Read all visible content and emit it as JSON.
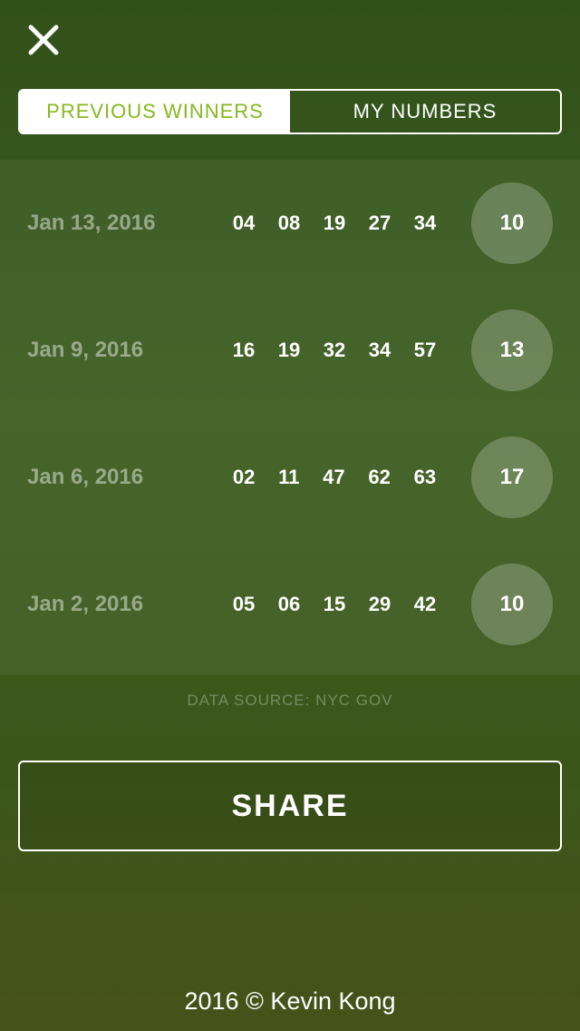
{
  "header": {
    "close_icon": "close-icon"
  },
  "tabs": [
    {
      "label": "PREVIOUS WINNERS",
      "active": true
    },
    {
      "label": "MY NUMBERS",
      "active": false
    }
  ],
  "draws": [
    {
      "date": "Jan 13, 2016",
      "numbers": [
        "04",
        "08",
        "19",
        "27",
        "34"
      ],
      "ball": "10"
    },
    {
      "date": "Jan 9, 2016",
      "numbers": [
        "16",
        "19",
        "32",
        "34",
        "57"
      ],
      "ball": "13"
    },
    {
      "date": "Jan 6, 2016",
      "numbers": [
        "02",
        "11",
        "47",
        "62",
        "63"
      ],
      "ball": "17"
    },
    {
      "date": "Jan 2, 2016",
      "numbers": [
        "05",
        "06",
        "15",
        "29",
        "42"
      ],
      "ball": "10"
    }
  ],
  "data_source": "DATA SOURCE: NYC GOV",
  "share_label": "SHARE",
  "footer": "2016 © Kevin Kong",
  "colors": {
    "accent": "#86b81e",
    "background": "#3a5c1e"
  }
}
